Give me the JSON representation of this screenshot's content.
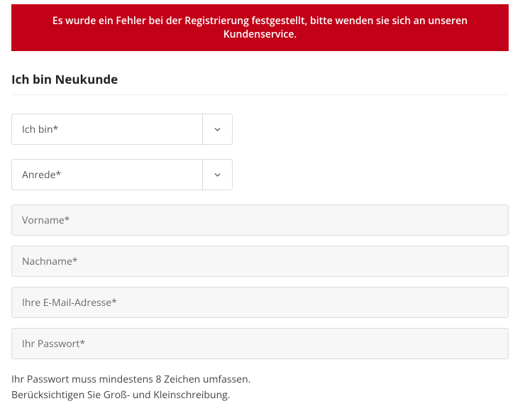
{
  "error_message": "Es wurde ein Fehler bei der Registrierung festgestellt, bitte wenden sie sich an unseren Kundenservice.",
  "heading": "Ich bin Neukunde",
  "select_type": {
    "label": "Ich bin*"
  },
  "select_salutation": {
    "label": "Anrede*"
  },
  "fields": {
    "firstname_placeholder": "Vorname*",
    "lastname_placeholder": "Nachname*",
    "email_placeholder": "Ihre E-Mail-Adresse*",
    "password_placeholder": "Ihr Passwort*"
  },
  "password_hint_line1": "Ihr Passwort muss mindestens 8 Zeichen umfassen.",
  "password_hint_line2": "Berücksichtigen Sie Groß- und Kleinschreibung.",
  "colors": {
    "error_bg": "#c20017"
  }
}
